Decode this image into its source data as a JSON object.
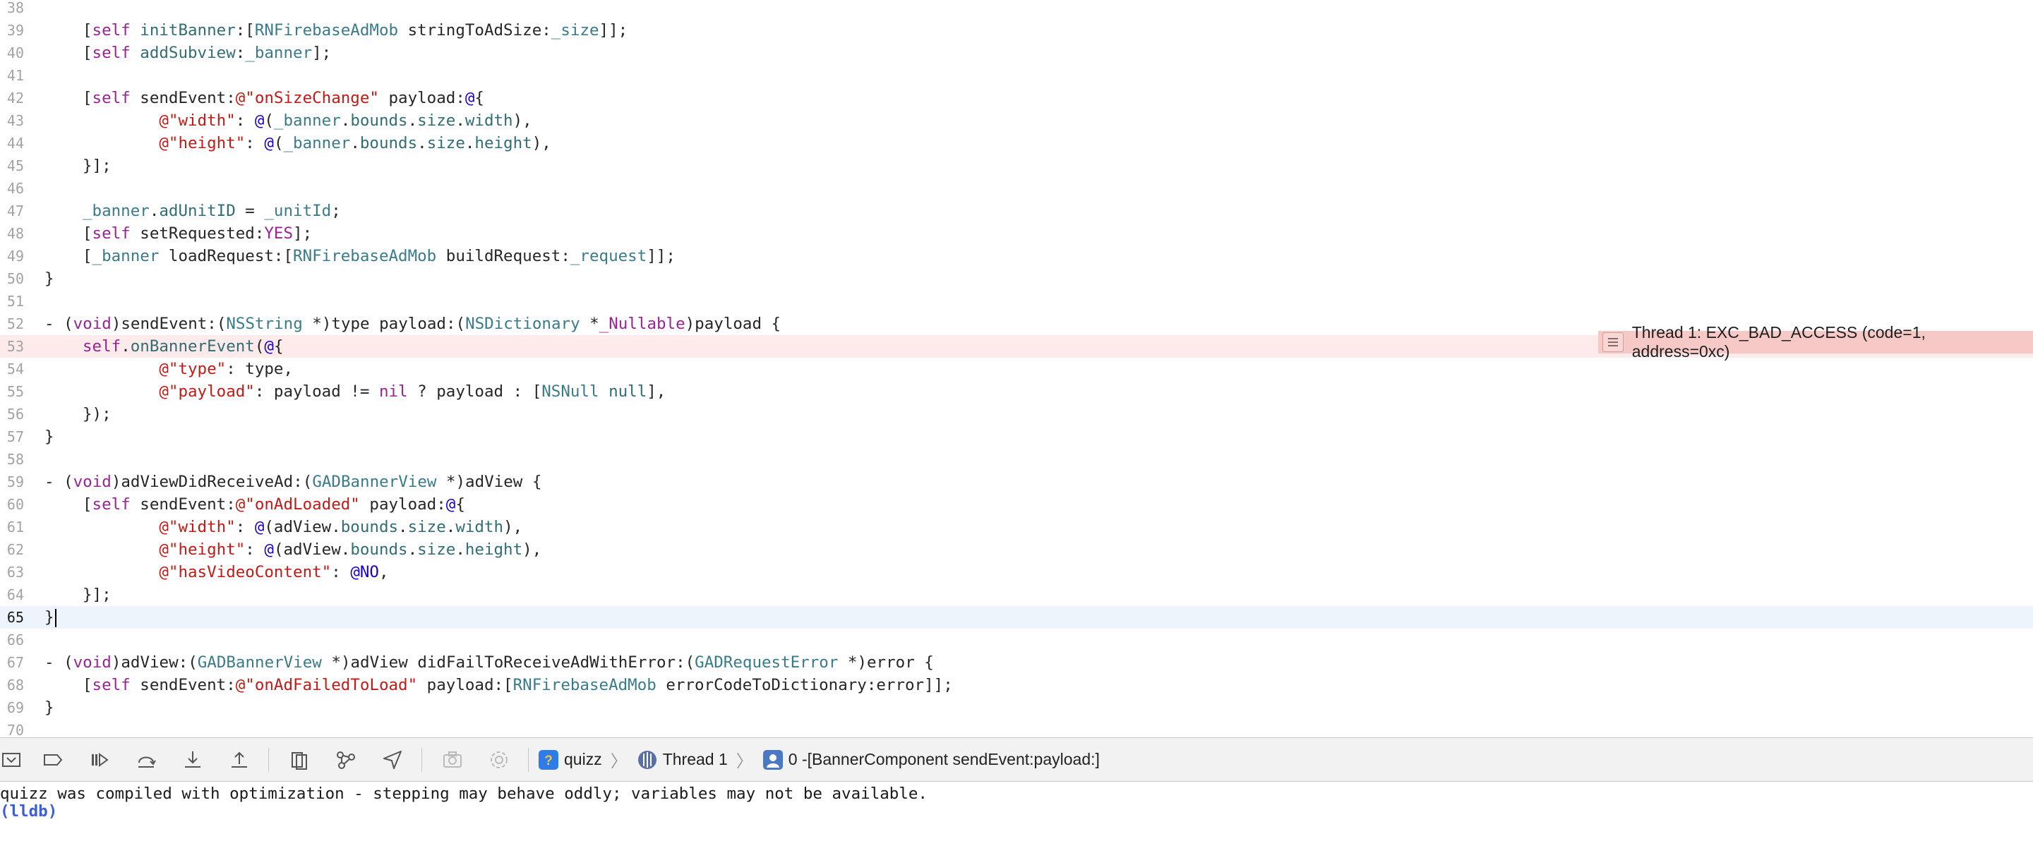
{
  "editor": {
    "lines": [
      {
        "n": "38",
        "tokens": []
      },
      {
        "n": "39",
        "tokens": [
          [
            "p",
            "["
          ],
          [
            "kw",
            "self"
          ],
          [
            "p",
            " "
          ],
          [
            "mth",
            "initBanner"
          ],
          [
            "p",
            ":["
          ],
          [
            "cls",
            "RNFirebaseAdMob"
          ],
          [
            "p",
            " stringToAdSize:"
          ],
          [
            "cls",
            "_size"
          ],
          [
            "p",
            "]];"
          ]
        ]
      },
      {
        "n": "40",
        "tokens": [
          [
            "p",
            "["
          ],
          [
            "kw",
            "self"
          ],
          [
            "p",
            " "
          ],
          [
            "mth",
            "addSubview"
          ],
          [
            "p",
            ":"
          ],
          [
            "cls",
            "_banner"
          ],
          [
            "p",
            "];"
          ]
        ]
      },
      {
        "n": "41",
        "tokens": []
      },
      {
        "n": "42",
        "tokens": [
          [
            "p",
            "["
          ],
          [
            "kw",
            "self"
          ],
          [
            "p",
            " sendEvent:"
          ],
          [
            "str",
            "@\"onSizeChange\""
          ],
          [
            "p",
            " payload:"
          ],
          [
            "num",
            "@"
          ],
          [
            "p",
            "{"
          ]
        ]
      },
      {
        "n": "43",
        "tokens": [
          [
            "p",
            "        "
          ],
          [
            "str",
            "@\"width\""
          ],
          [
            "p",
            ": "
          ],
          [
            "num",
            "@"
          ],
          [
            "p",
            "("
          ],
          [
            "cls",
            "_banner"
          ],
          [
            "p",
            "."
          ],
          [
            "mth",
            "bounds"
          ],
          [
            "p",
            "."
          ],
          [
            "mth",
            "size"
          ],
          [
            "p",
            "."
          ],
          [
            "mth",
            "width"
          ],
          [
            "p",
            "),"
          ]
        ]
      },
      {
        "n": "44",
        "tokens": [
          [
            "p",
            "        "
          ],
          [
            "str",
            "@\"height\""
          ],
          [
            "p",
            ": "
          ],
          [
            "num",
            "@"
          ],
          [
            "p",
            "("
          ],
          [
            "cls",
            "_banner"
          ],
          [
            "p",
            "."
          ],
          [
            "mth",
            "bounds"
          ],
          [
            "p",
            "."
          ],
          [
            "mth",
            "size"
          ],
          [
            "p",
            "."
          ],
          [
            "mth",
            "height"
          ],
          [
            "p",
            "),"
          ]
        ]
      },
      {
        "n": "45",
        "tokens": [
          [
            "p",
            "}];"
          ]
        ]
      },
      {
        "n": "46",
        "tokens": []
      },
      {
        "n": "47",
        "tokens": [
          [
            "cls",
            "_banner"
          ],
          [
            "p",
            "."
          ],
          [
            "mth",
            "adUnitID"
          ],
          [
            "p",
            " = "
          ],
          [
            "cls",
            "_unitId"
          ],
          [
            "p",
            ";"
          ]
        ]
      },
      {
        "n": "48",
        "tokens": [
          [
            "p",
            "["
          ],
          [
            "kw",
            "self"
          ],
          [
            "p",
            " setRequested:"
          ],
          [
            "kw",
            "YES"
          ],
          [
            "p",
            "];"
          ]
        ]
      },
      {
        "n": "49",
        "tokens": [
          [
            "p",
            "["
          ],
          [
            "cls",
            "_banner"
          ],
          [
            "p",
            " loadRequest:["
          ],
          [
            "cls",
            "RNFirebaseAdMob"
          ],
          [
            "p",
            " buildRequest:"
          ],
          [
            "cls",
            "_request"
          ],
          [
            "p",
            "]];"
          ]
        ]
      },
      {
        "n": "50",
        "tokens": [
          [
            "p",
            "}"
          ]
        ]
      },
      {
        "n": "51",
        "tokens": []
      },
      {
        "n": "52",
        "tokens": [
          [
            "p",
            "- ("
          ],
          [
            "kw",
            "void"
          ],
          [
            "p",
            ")sendEvent:("
          ],
          [
            "cls",
            "NSString"
          ],
          [
            "p",
            " *)type payload:("
          ],
          [
            "cls",
            "NSDictionary"
          ],
          [
            "p",
            " *"
          ],
          [
            "kw",
            "_Nullable"
          ],
          [
            "p",
            ")payload {"
          ]
        ]
      },
      {
        "n": "53",
        "tokens": [
          [
            "kw",
            "self"
          ],
          [
            "p",
            "."
          ],
          [
            "mth",
            "onBannerEvent"
          ],
          [
            "p",
            "("
          ],
          [
            "num",
            "@"
          ],
          [
            "p",
            "{"
          ]
        ]
      },
      {
        "n": "54",
        "tokens": [
          [
            "p",
            "        "
          ],
          [
            "str",
            "@\"type\""
          ],
          [
            "p",
            ": type,"
          ]
        ]
      },
      {
        "n": "55",
        "tokens": [
          [
            "p",
            "        "
          ],
          [
            "str",
            "@\"payload\""
          ],
          [
            "p",
            ": payload != "
          ],
          [
            "kw",
            "nil"
          ],
          [
            "p",
            " ? payload : ["
          ],
          [
            "cls",
            "NSNull"
          ],
          [
            "p",
            " "
          ],
          [
            "mth",
            "null"
          ],
          [
            "p",
            "],"
          ]
        ]
      },
      {
        "n": "56",
        "tokens": [
          [
            "p",
            "});"
          ]
        ]
      },
      {
        "n": "57",
        "tokens": [
          [
            "p",
            "}"
          ]
        ]
      },
      {
        "n": "58",
        "tokens": []
      },
      {
        "n": "59",
        "tokens": [
          [
            "p",
            "- ("
          ],
          [
            "kw",
            "void"
          ],
          [
            "p",
            ")adViewDidReceiveAd:("
          ],
          [
            "cls",
            "GADBannerView"
          ],
          [
            "p",
            " *)adView {"
          ]
        ]
      },
      {
        "n": "60",
        "tokens": [
          [
            "p",
            "["
          ],
          [
            "kw",
            "self"
          ],
          [
            "p",
            " sendEvent:"
          ],
          [
            "str",
            "@\"onAdLoaded\""
          ],
          [
            "p",
            " payload:"
          ],
          [
            "num",
            "@"
          ],
          [
            "p",
            "{"
          ]
        ]
      },
      {
        "n": "61",
        "tokens": [
          [
            "p",
            "        "
          ],
          [
            "str",
            "@\"width\""
          ],
          [
            "p",
            ": "
          ],
          [
            "num",
            "@"
          ],
          [
            "p",
            "(adView."
          ],
          [
            "mth",
            "bounds"
          ],
          [
            "p",
            "."
          ],
          [
            "mth",
            "size"
          ],
          [
            "p",
            "."
          ],
          [
            "mth",
            "width"
          ],
          [
            "p",
            "),"
          ]
        ]
      },
      {
        "n": "62",
        "tokens": [
          [
            "p",
            "        "
          ],
          [
            "str",
            "@\"height\""
          ],
          [
            "p",
            ": "
          ],
          [
            "num",
            "@"
          ],
          [
            "p",
            "(adView."
          ],
          [
            "mth",
            "bounds"
          ],
          [
            "p",
            "."
          ],
          [
            "mth",
            "size"
          ],
          [
            "p",
            "."
          ],
          [
            "mth",
            "height"
          ],
          [
            "p",
            "),"
          ]
        ]
      },
      {
        "n": "63",
        "tokens": [
          [
            "p",
            "        "
          ],
          [
            "str",
            "@\"hasVideoContent\""
          ],
          [
            "p",
            ": "
          ],
          [
            "num",
            "@NO"
          ],
          [
            "p",
            ","
          ]
        ]
      },
      {
        "n": "64",
        "tokens": [
          [
            "p",
            "}];"
          ]
        ]
      },
      {
        "n": "65",
        "tokens": [
          [
            "p",
            "}"
          ]
        ]
      },
      {
        "n": "66",
        "tokens": []
      },
      {
        "n": "67",
        "tokens": [
          [
            "p",
            "- ("
          ],
          [
            "kw",
            "void"
          ],
          [
            "p",
            ")adView:("
          ],
          [
            "cls",
            "GADBannerView"
          ],
          [
            "p",
            " *)adView didFailToReceiveAdWithError:("
          ],
          [
            "cls",
            "GADRequestError"
          ],
          [
            "p",
            " *)error {"
          ]
        ]
      },
      {
        "n": "68",
        "tokens": [
          [
            "p",
            "["
          ],
          [
            "kw",
            "self"
          ],
          [
            "p",
            " sendEvent:"
          ],
          [
            "str",
            "@\"onAdFailedToLoad\""
          ],
          [
            "p",
            " payload:["
          ],
          [
            "cls",
            "RNFirebaseAdMob"
          ],
          [
            "p",
            " errorCodeToDictionary:error]];"
          ]
        ]
      },
      {
        "n": "69",
        "tokens": [
          [
            "p",
            "}"
          ]
        ]
      },
      {
        "n": "70",
        "tokens": []
      }
    ],
    "error_line": "53",
    "current_line": "65",
    "error_message": "Thread 1: EXC_BAD_ACCESS (code=1, address=0xc)"
  },
  "debug_bar": {
    "buttons": [
      "hide-debug-area",
      "breakpoints-toggle",
      "continue",
      "step-over",
      "step-into",
      "step-out",
      "view-debugger",
      "memory-graph",
      "simulate-location",
      "capture-screenshot",
      "environment-overrides"
    ],
    "app_name": "quizz",
    "thread": "Thread 1",
    "frame": "0 -[BannerComponent sendEvent:payload:]"
  },
  "console": {
    "message": "quizz was compiled with optimization - stepping may behave oddly; variables may not be available.",
    "prompt": "(lldb)"
  },
  "colors": {
    "keyword": "#9b2393",
    "class": "#3a7b8a",
    "string": "#c41a16",
    "number": "#1c00cf",
    "error_bg": "#fdeaea",
    "current_bg": "#eef4fb"
  }
}
